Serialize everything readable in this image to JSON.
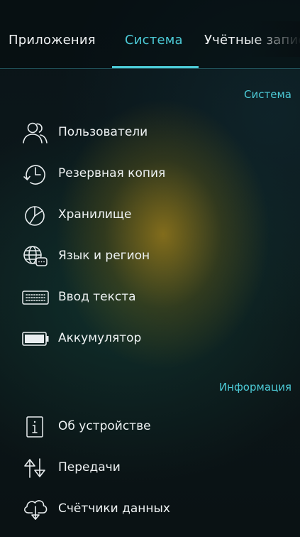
{
  "tabs": [
    {
      "label": "Приложения",
      "active": false
    },
    {
      "label": "Система",
      "active": true
    },
    {
      "label": "Учётные записи",
      "active": false
    }
  ],
  "sections": {
    "system": {
      "header": "Система",
      "items": [
        {
          "label": "Пользователи",
          "icon": "users-icon"
        },
        {
          "label": "Резервная копия",
          "icon": "backup-clock-icon"
        },
        {
          "label": "Хранилище",
          "icon": "storage-pie-icon"
        },
        {
          "label": "Язык и регион",
          "icon": "language-globe-icon"
        },
        {
          "label": "Ввод текста",
          "icon": "keyboard-icon"
        },
        {
          "label": "Аккумулятор",
          "icon": "battery-icon"
        }
      ]
    },
    "info": {
      "header": "Информация",
      "items": [
        {
          "label": "Об устройстве",
          "icon": "info-icon"
        },
        {
          "label": "Передачи",
          "icon": "transfers-icon"
        },
        {
          "label": "Счётчики данных",
          "icon": "cloud-download-icon"
        }
      ]
    }
  },
  "colors": {
    "accent": "#4ccad6",
    "text": "#eef2f3"
  }
}
